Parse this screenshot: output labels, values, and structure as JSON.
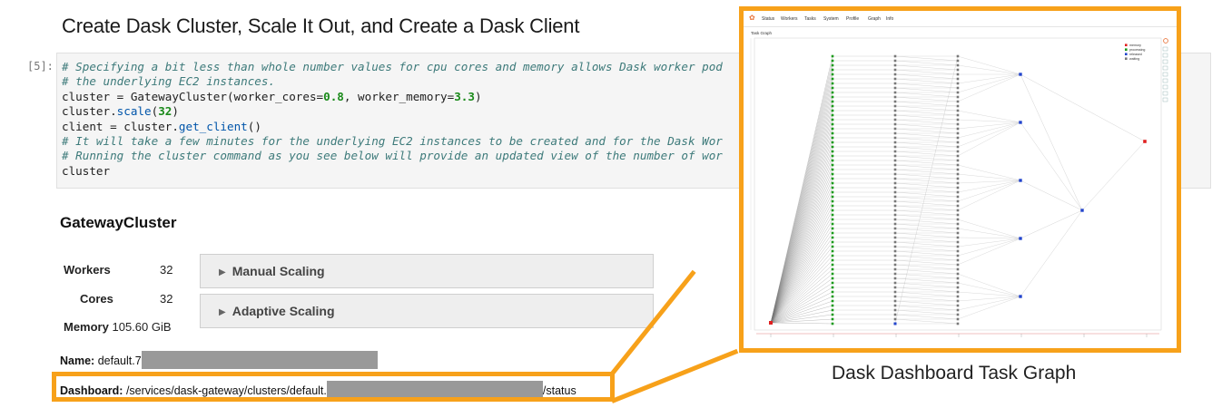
{
  "heading": "Create Dask Cluster, Scale It Out, and Create a Dask Client",
  "cell": {
    "prompt": "[5]:",
    "lines": {
      "l1": "# Specifying a bit less than whole number values for cpu cores and memory allows Dask worker pod",
      "l2": "# the underlying EC2 instances.",
      "l3_a": "cluster = GatewayCluster(worker_cores=",
      "l3_b": "0.8",
      "l3_c": ", worker_memory=",
      "l3_d": "3.3",
      "l3_e": ")",
      "l4_a": "cluster.",
      "l4_b": "scale",
      "l4_c": "(",
      "l4_d": "32",
      "l4_e": ")",
      "l5_a": "client = cluster.",
      "l5_b": "get_client",
      "l5_c": "()",
      "l6": "# It will take a few minutes for the underlying EC2 instances to be created and for the Dask Wor",
      "l7": "# Running the cluster command as you see below will provide an updated view of the number of wor",
      "l8": "cluster"
    }
  },
  "gateway": {
    "title": "GatewayCluster",
    "workers_label": "Workers",
    "workers_value": "32",
    "cores_label": "Cores",
    "cores_value": "32",
    "memory_label": "Memory",
    "memory_value": "105.60 GiB",
    "manual_scaling": "Manual Scaling",
    "adaptive_scaling": "Adaptive Scaling",
    "name_label": "Name:",
    "name_value": "default.7",
    "dashboard_label": "Dashboard:",
    "dashboard_prefix": "/services/dask-gateway/clusters/default.",
    "dashboard_suffix": "/status"
  },
  "dashboard": {
    "nav": [
      "Status",
      "Workers",
      "Tasks",
      "System",
      "Profile",
      "Graph",
      "Info"
    ],
    "subtitle": "Task Graph",
    "legend": [
      {
        "label": "memory",
        "color": "#e02020"
      },
      {
        "label": "processing",
        "color": "#1a9a1a"
      },
      {
        "label": "released",
        "color": "#2244cc"
      },
      {
        "label": "waiting",
        "color": "#777777"
      }
    ]
  },
  "caption": "Dask Dashboard Task Graph",
  "colors": {
    "highlight": "#f7a11a",
    "redaction": "#999999",
    "code_bg": "#f5f5f5"
  }
}
